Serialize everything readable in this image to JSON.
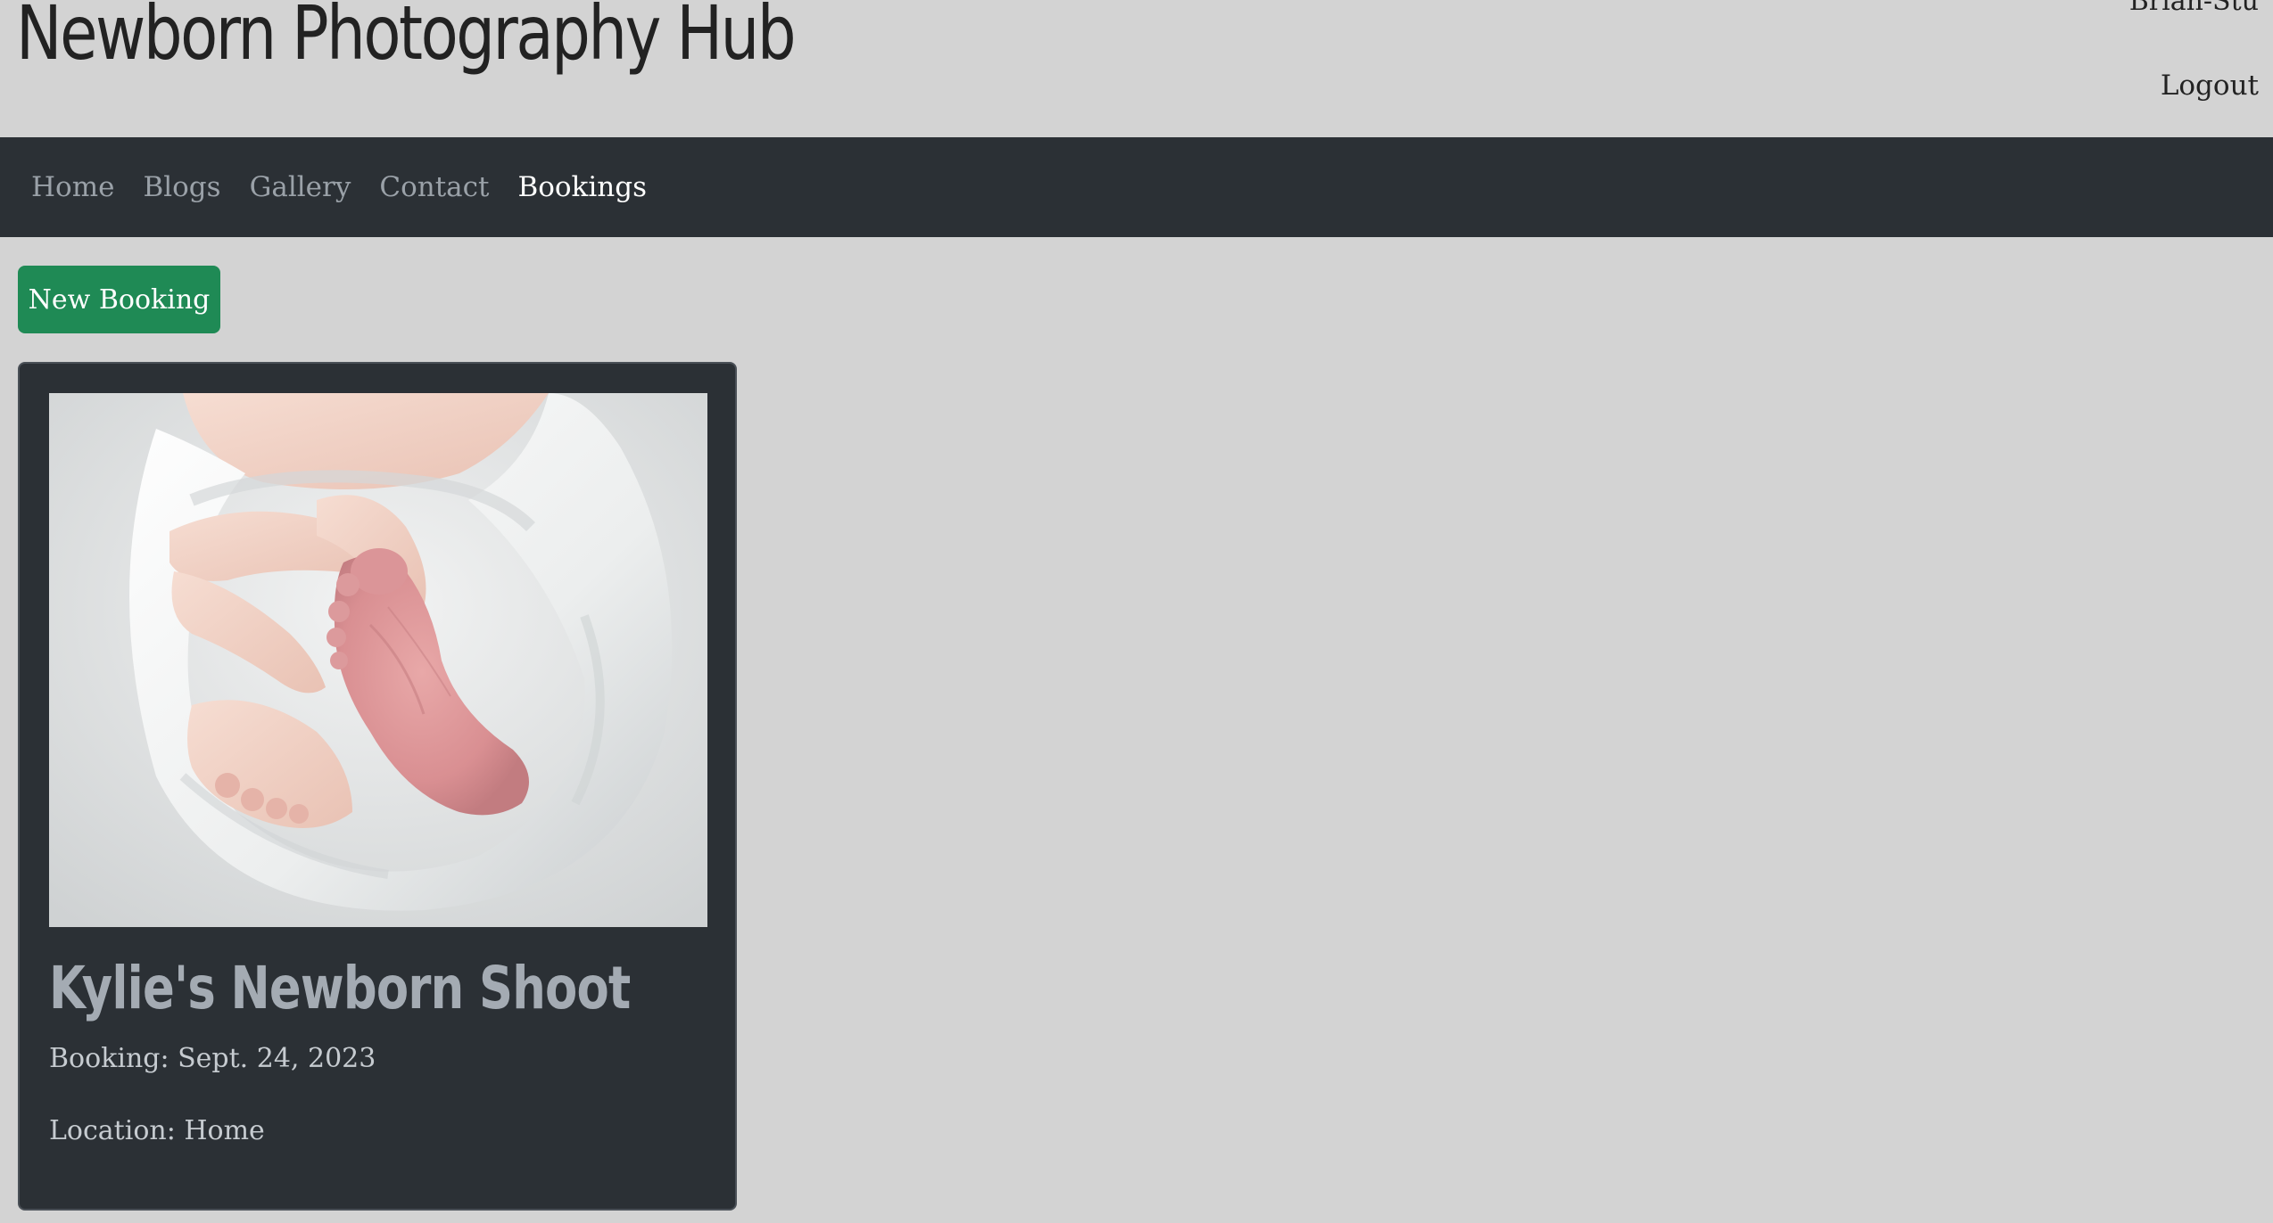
{
  "header": {
    "site_title": "Newborn Photography Hub",
    "user_name": "Brian-Stu",
    "logout_label": "Logout"
  },
  "nav": {
    "items": [
      {
        "label": "Home",
        "active": false
      },
      {
        "label": "Blogs",
        "active": false
      },
      {
        "label": "Gallery",
        "active": false
      },
      {
        "label": "Contact",
        "active": false
      },
      {
        "label": "Bookings",
        "active": true
      }
    ]
  },
  "actions": {
    "new_booking_label": "New Booking"
  },
  "bookings": [
    {
      "title": "Kylie's Newborn Shoot",
      "date_text": "Booking: Sept. 24, 2023",
      "location_text": "Location: Home",
      "image_subject": "newborn-feet-in-white-wrap"
    }
  ],
  "colors": {
    "page_bg": "#d3d3d3",
    "navbar_bg": "#2b3035",
    "card_bg": "#2b3035",
    "accent_button": "#1f8a55",
    "nav_inactive": "#9aa1a8",
    "nav_active": "#ffffff",
    "card_title": "#a4abb3"
  }
}
